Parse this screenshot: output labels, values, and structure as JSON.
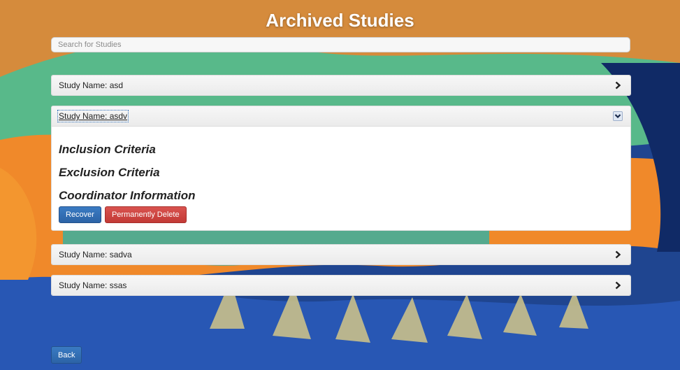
{
  "page": {
    "title": "Archived Studies"
  },
  "search": {
    "placeholder": "Search for Studies"
  },
  "studies": [
    {
      "label": "Study Name: asd",
      "expanded": false
    },
    {
      "label": "Study Name: asdv",
      "expanded": true
    },
    {
      "label": "Study Name: sadva",
      "expanded": false
    },
    {
      "label": "Study Name: ssas",
      "expanded": false
    }
  ],
  "expanded_study": {
    "inclusion": "Inclusion Criteria",
    "exclusion": "Exclusion Criteria",
    "coordinator": "Coordinator Information",
    "recover_label": "Recover",
    "delete_label": "Permanently Delete"
  },
  "icons": {
    "collapsed": "chevron-right-icon",
    "expanded": "chevron-down-icon"
  },
  "footer": {
    "back_label": "Back"
  },
  "colors": {
    "primary": "#2f6fb8",
    "danger": "#c9302c",
    "background_blue": "#1d3f86",
    "background_orange": "#f08a2b",
    "background_green": "#5fc08e"
  }
}
